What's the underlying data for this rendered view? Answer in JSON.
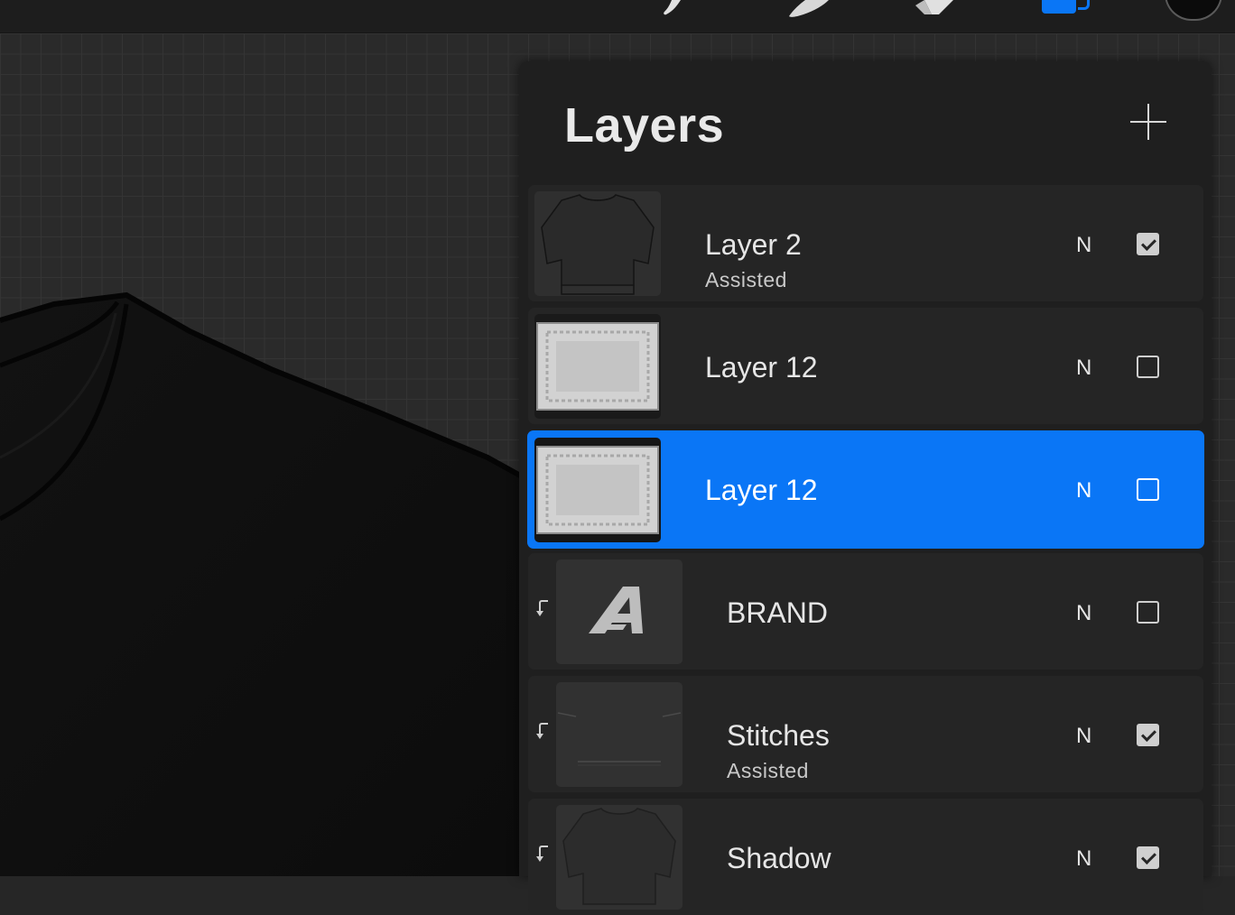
{
  "toolbar": {
    "tools": [
      "brush-tool",
      "smudge-tool",
      "eraser-tool",
      "layers-tool",
      "color-picker"
    ],
    "accent_color": "#0a76f6",
    "current_color": "#0b0b0b"
  },
  "panel": {
    "title": "Layers",
    "add_icon": "plus-icon"
  },
  "layers": [
    {
      "name": "Layer 2",
      "subtitle": "Assisted",
      "blend": "N",
      "visible": true,
      "clipped": false,
      "selected": false,
      "thumb": "tshirt-outline"
    },
    {
      "name": "Layer 12",
      "subtitle": "",
      "blend": "N",
      "visible": false,
      "clipped": false,
      "selected": false,
      "thumb": "ornamental-frame"
    },
    {
      "name": "Layer 12",
      "subtitle": "",
      "blend": "N",
      "visible": false,
      "clipped": false,
      "selected": true,
      "thumb": "ornamental-frame"
    },
    {
      "name": "BRAND",
      "subtitle": "",
      "blend": "N",
      "visible": false,
      "clipped": true,
      "selected": false,
      "thumb": "letter-a-logo"
    },
    {
      "name": "Stitches",
      "subtitle": "Assisted",
      "blend": "N",
      "visible": true,
      "clipped": true,
      "selected": false,
      "thumb": "stitch-lines"
    },
    {
      "name": "Shadow",
      "subtitle": "",
      "blend": "N",
      "visible": true,
      "clipped": true,
      "selected": false,
      "thumb": "tshirt-shadow"
    }
  ]
}
